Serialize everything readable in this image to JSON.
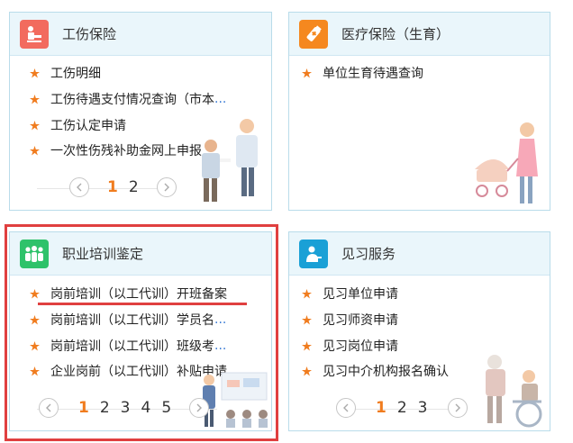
{
  "cards": {
    "injury": {
      "title": "工伤保险",
      "icon": "injured-person-icon",
      "icon_bg": "#f26b5e",
      "items": [
        {
          "text": "工伤明细",
          "more": ""
        },
        {
          "text": "工伤待遇支付情况查询（市本",
          "more": "..."
        },
        {
          "text": "工伤认定申请",
          "more": ""
        },
        {
          "text": "一次性伤残补助金网上申报",
          "more": ""
        }
      ],
      "pager": {
        "pages": [
          "1",
          "2"
        ],
        "current": "1"
      }
    },
    "medical": {
      "title": "医疗保险（生育）",
      "icon": "medicine-bottle-icon",
      "icon_bg": "#f5881f",
      "items": [
        {
          "text": "单位生育待遇查询",
          "more": ""
        }
      ]
    },
    "training": {
      "title": "职业培训鉴定",
      "icon": "people-group-icon",
      "icon_bg": "#2ec26a",
      "items": [
        {
          "text": "岗前培训（以工代训）开班备案",
          "more": ""
        },
        {
          "text": "岗前培训（以工代训）学员名",
          "more": "..."
        },
        {
          "text": "岗前培训（以工代训）班级考",
          "more": "..."
        },
        {
          "text": "企业岗前（以工代训）补贴申请",
          "more": ""
        }
      ],
      "pager": {
        "pages": [
          "1",
          "2",
          "3",
          "4",
          "5"
        ],
        "current": "1"
      }
    },
    "internship": {
      "title": "见习服务",
      "icon": "person-at-desk-icon",
      "icon_bg": "#1aa0d6",
      "items": [
        {
          "text": "见习单位申请",
          "more": ""
        },
        {
          "text": "见习师资申请",
          "more": ""
        },
        {
          "text": "见习岗位申请",
          "more": ""
        },
        {
          "text": "见习中介机构报名确认",
          "more": ""
        }
      ],
      "pager": {
        "pages": [
          "1",
          "2",
          "3"
        ],
        "current": "1"
      }
    }
  },
  "colors": {
    "accent_orange": "#f07c1e",
    "link_blue": "#3a7bd5",
    "highlight_red": "#e04040"
  }
}
